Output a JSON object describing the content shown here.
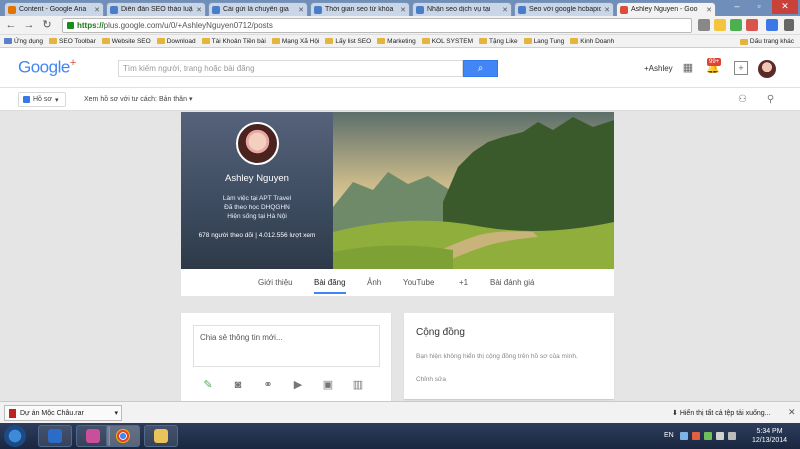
{
  "browser": {
    "tabs": [
      {
        "title": "Content - Google Ana",
        "color": "#e37400"
      },
      {
        "title": "Diễn đàn SEO thảo luậ",
        "color": "#4a7dc9"
      },
      {
        "title": "Cài gửi là chuyên gia",
        "color": "#4a7dc9"
      },
      {
        "title": "Thời gian seo từ khóa",
        "color": "#4a7dc9"
      },
      {
        "title": "Nhận seo dịch vụ tại",
        "color": "#4a7dc9"
      },
      {
        "title": "Seo với google hcbapid",
        "color": "#4a7dc9"
      },
      {
        "title": "Ashley Nguyen - Goo",
        "color": "#dd4b39"
      }
    ],
    "url_scheme": "https://",
    "url_rest": "plus.google.com/u/0/+AshleyNguyen0712/posts",
    "bookmarks": [
      "Ứng dụng",
      "SEO Toolbar",
      "Website SEO",
      "Download",
      "Tài Khoản Tiền bài",
      "Mạng Xã Hội",
      "Lấy list SEO",
      "Marketing",
      "KOL SYSTEM",
      "Tặng Like",
      "Lang Tung",
      "Kinh Doanh"
    ],
    "bookmark_other": "Dấu trang khác"
  },
  "gplus": {
    "logo_word": "Google",
    "logo_plus": "+",
    "search_placeholder": "Tìm kiếm người, trang hoặc bài đăng",
    "search_icon": "⌕",
    "user_name": "+Ashley",
    "notification_count": "99+",
    "home_label": "Hồ sơ",
    "breadcrumb": "Xem hồ sơ với tư cách: Bản thân"
  },
  "profile": {
    "name": "Ashley Nguyen",
    "work": "Làm việc tại APT Travel",
    "school": "Đã theo học DHQGHN",
    "lives": "Hiện sống tại Hà Nội",
    "stats": "678 người theo dõi | 4.012.556 lượt xem",
    "tabs": [
      "Giới thiệu",
      "Bài đăng",
      "Ảnh",
      "YouTube",
      "+1",
      "Bài đánh giá"
    ]
  },
  "share": {
    "placeholder": "Chia sẻ thông tin mới..."
  },
  "community": {
    "title": "Cộng đồng",
    "description": "Bạn hiện không hiển thị cộng đồng trên hồ sơ của mình.",
    "edit": "Chỉnh sửa"
  },
  "downloads": {
    "file": "Dự án Mộc Châu.rar",
    "show_all": "Hiển thị tất cả tệp tải xuống..."
  },
  "taskbar": {
    "lang": "EN",
    "time": "5:34 PM",
    "date": "12/13/2014"
  },
  "colors": {
    "accent": "#4285f4",
    "red": "#db4437"
  }
}
